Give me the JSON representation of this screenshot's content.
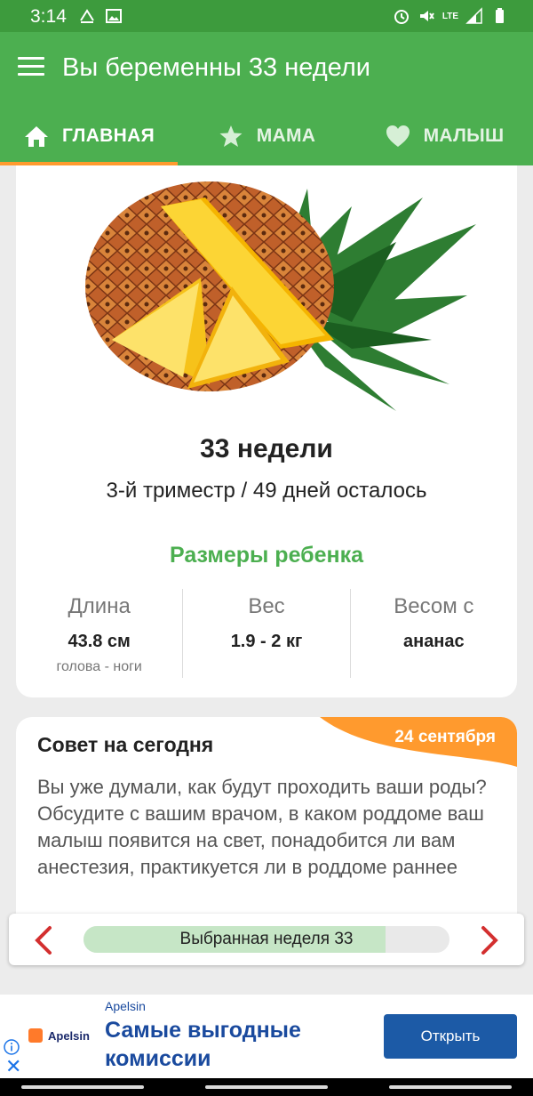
{
  "status_bar": {
    "time": "3:14",
    "left_icons": [
      "download-icon",
      "image-icon"
    ],
    "right_icons": [
      "alarm-icon",
      "mute-icon",
      "lte-icon",
      "signal-icon",
      "battery-icon"
    ],
    "lte_label": "LTE"
  },
  "app_bar": {
    "title": "Вы беременны 33 недели",
    "menu_icon": "hamburger-menu-icon"
  },
  "tabs": [
    {
      "label": "ГЛАВНАЯ",
      "icon": "home-icon",
      "active": true
    },
    {
      "label": "МАМА",
      "icon": "star-icon",
      "active": false
    },
    {
      "label": "МАЛЫШ",
      "icon": "heart-icon",
      "active": false
    }
  ],
  "main_card": {
    "image": "pineapple",
    "week_title": "33 недели",
    "trimester_text": "3-й триместр / 49 дней осталось",
    "sizes_title": "Размеры ребенка",
    "stats": [
      {
        "label": "Длина",
        "value": "43.8 см",
        "sub": "голова - ноги"
      },
      {
        "label": "Вес",
        "value": "1.9 - 2 кг",
        "sub": ""
      },
      {
        "label": "Весом с",
        "value": "ананас",
        "sub": ""
      }
    ]
  },
  "tip_card": {
    "title": "Совет на сегодня",
    "date": "24 сентября",
    "text": "Вы уже думали, как будут проходить ваши роды? Обсудите с вашим врачом, в каком роддоме ваш малыш появится на свет, понадобится ли вам анестезия, практикуется ли в роддоме раннее"
  },
  "week_selector": {
    "label": "Выбранная неделя 33",
    "progress_fraction": 0.825
  },
  "ad": {
    "brand": "Apelsin",
    "logo_text": "Apelsin",
    "headline": "Самые выгодные комиссии",
    "button": "Открыть"
  },
  "colors": {
    "status_bar": "#3d9b3d",
    "primary": "#4caf50",
    "tab_indicator": "#ff9a2e",
    "date_badge": "#ff9a2e",
    "arrow": "#d32f2f",
    "progress_fill": "#c6e6c6",
    "ad_button": "#1c5aa6",
    "ad_text": "#1a4a9e"
  }
}
